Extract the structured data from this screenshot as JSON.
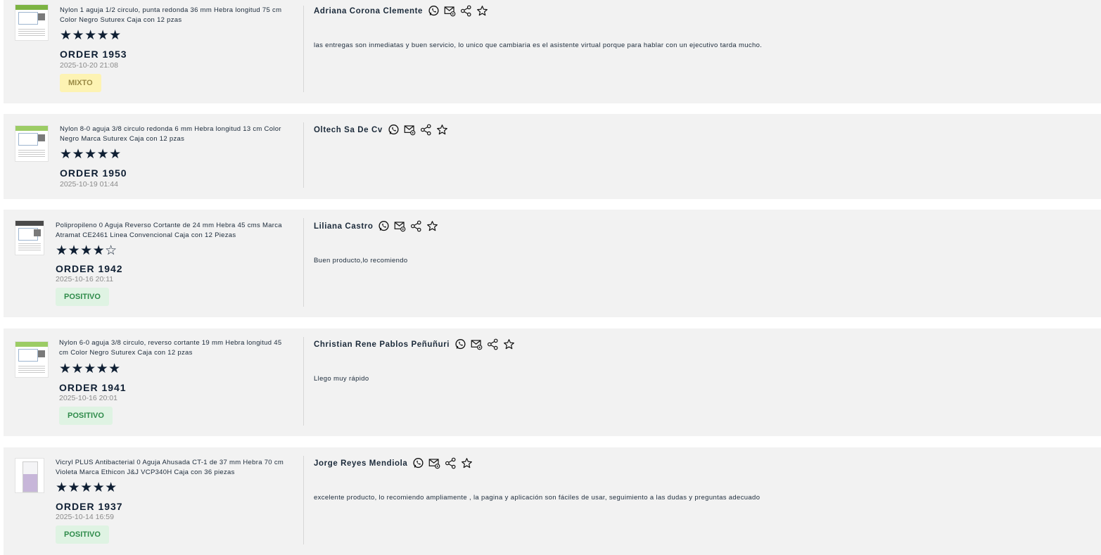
{
  "reviews": [
    {
      "product": "Nylon 1 aguja 1/2 circulo, punta redonda 36 mm Hebra longitud 75 cm Color Negro Suturex Caja con 12 pzas",
      "stars": "★★★★★",
      "rating": 5,
      "order": "ORDER 1953",
      "date": "2025-10-20 21:08",
      "sentiment": "MIXTO",
      "customer": "Adriana Corona Clemente",
      "comment": "las entregas son inmediatas y buen servicio, lo unico que cambiaria es el asistente virtual porque para hablar con un ejecutivo tarda mucho."
    },
    {
      "product": "Nylon 8-0 aguja 3/8 circulo redonda 6 mm Hebra longitud 13 cm Color Negro Marca Suturex Caja con 12 pzas",
      "stars": "★★★★★",
      "rating": 5,
      "order": "ORDER 1950",
      "date": "2025-10-19 01:44",
      "sentiment": "",
      "customer": "Oltech Sa De Cv",
      "comment": ""
    },
    {
      "product": "Polipropileno 0 Aguja Reverso Cortante de 24 mm Hebra 45 cms Marca Atramat CE2461 Linea Convencional Caja con 12 Piezas",
      "stars": "★★★★☆",
      "rating": 4,
      "order": "ORDER 1942",
      "date": "2025-10-16 20:11",
      "sentiment": "POSITIVO",
      "customer": "Liliana Castro",
      "comment": "Buen producto,lo recomiendo"
    },
    {
      "product": "Nylon 6-0 aguja 3/8 circulo, reverso cortante 19 mm Hebra longitud 45 cm Color Negro Suturex Caja con 12 pzas",
      "stars": "★★★★★",
      "rating": 5,
      "order": "ORDER 1941",
      "date": "2025-10-16 20:01",
      "sentiment": "POSITIVO",
      "customer": "Christian Rene Pablos Peñuñuri",
      "comment": "Llego muy rápido"
    },
    {
      "product": "Vicryl PLUS Antibacterial 0 Aguja Ahusada CT-1 de 37 mm Hebra 70 cm Violeta Marca Ethicon J&J VCP340H Caja con 36 piezas",
      "stars": "★★★★★",
      "rating": 5,
      "order": "ORDER 1937",
      "date": "2025-10-14 16:59",
      "sentiment": "POSITIVO",
      "customer": "Jorge Reyes Mendiola",
      "comment": "excelente producto, lo recomiendo ampliamente , la pagina y aplicación son fáciles de usar, seguimiento a las dudas y preguntas adecuado"
    }
  ],
  "icons": [
    "whatsapp-icon",
    "email-icon",
    "share-icon",
    "favorite-star-icon"
  ],
  "colors": {
    "card_bg": "#f2f2f2",
    "mixto_bg": "#fdf3b3",
    "positivo_bg": "#dff3e3",
    "positivo_text": "#2e8b4a",
    "star": "#0f1f33"
  }
}
